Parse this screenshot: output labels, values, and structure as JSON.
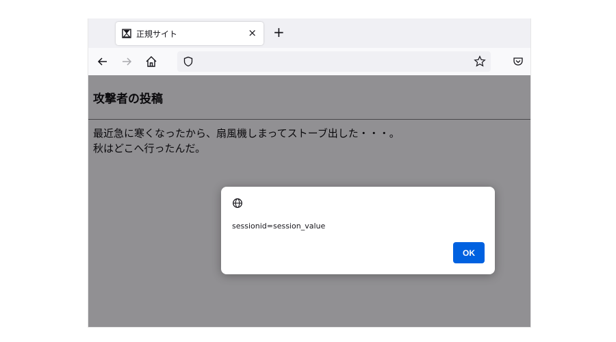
{
  "tab": {
    "title": "正規サイト",
    "close_glyph": "×",
    "new_tab_glyph": "+"
  },
  "navbar": {
    "icons": [
      "back-arrow-icon",
      "forward-arrow-icon",
      "home-icon",
      "shield-icon",
      "bookmark-star-icon",
      "pocket-icon"
    ]
  },
  "page": {
    "title": "攻撃者の投稿",
    "body_lines": [
      "最近急に寒くなったから、扇風機しまってストーブ出した・・・。",
      "秋はどこへ行ったんだ。"
    ]
  },
  "dialog": {
    "icon": "globe-icon",
    "message": "sessionid=session_value",
    "ok_label": "OK"
  },
  "colors": {
    "accent": "#0061e0",
    "overlay": "#8d8d91",
    "tabstrip": "#f0f0f4"
  }
}
